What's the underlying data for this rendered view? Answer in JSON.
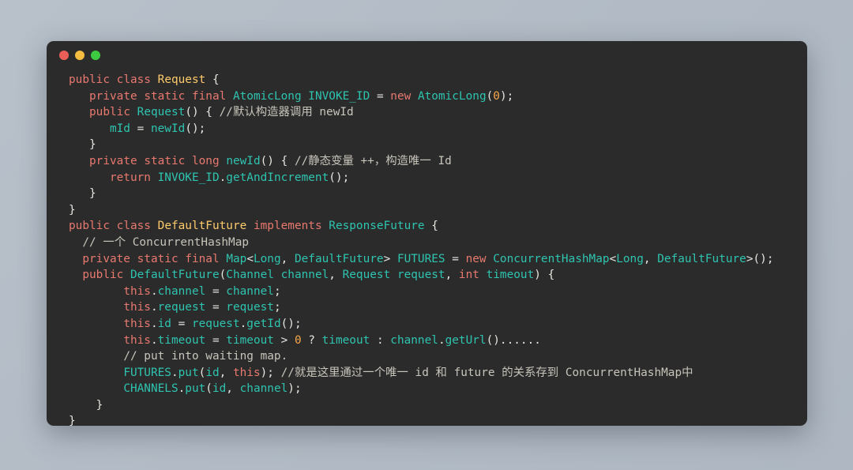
{
  "window": {
    "background_color": "#2b2b2b",
    "page_background_color": "#b4bdc7",
    "traffic_lights": [
      {
        "name": "close-button",
        "color": "#ec5f58"
      },
      {
        "name": "minimize-button",
        "color": "#f4bd3f"
      },
      {
        "name": "maximize-button",
        "color": "#3dc940"
      }
    ]
  },
  "theme": {
    "keyword": "#e8796f",
    "class_name": "#ffcb6b",
    "type": "#2ec4b0",
    "comment": "#c7c4ba",
    "number": "#f6a84b",
    "plain": "#e6e6e0"
  },
  "code": {
    "language": "java",
    "lines": [
      {
        "indent": 0,
        "tokens": [
          {
            "t": "public",
            "c": "kw"
          },
          {
            "t": " ",
            "c": "plain"
          },
          {
            "t": "class",
            "c": "kw"
          },
          {
            "t": " ",
            "c": "plain"
          },
          {
            "t": "Request",
            "c": "cls"
          },
          {
            "t": " {",
            "c": "plain"
          }
        ]
      },
      {
        "indent": 0,
        "tokens": [
          {
            "t": "   ",
            "c": "plain"
          },
          {
            "t": "private",
            "c": "kw"
          },
          {
            "t": " ",
            "c": "plain"
          },
          {
            "t": "static",
            "c": "kw"
          },
          {
            "t": " ",
            "c": "plain"
          },
          {
            "t": "final",
            "c": "kw"
          },
          {
            "t": " ",
            "c": "plain"
          },
          {
            "t": "AtomicLong",
            "c": "type"
          },
          {
            "t": " ",
            "c": "plain"
          },
          {
            "t": "INVOKE_ID",
            "c": "type"
          },
          {
            "t": " ",
            "c": "plain"
          },
          {
            "t": "=",
            "c": "plain"
          },
          {
            "t": " ",
            "c": "plain"
          },
          {
            "t": "new",
            "c": "kw"
          },
          {
            "t": " ",
            "c": "plain"
          },
          {
            "t": "AtomicLong",
            "c": "type"
          },
          {
            "t": "(",
            "c": "plain"
          },
          {
            "t": "0",
            "c": "num"
          },
          {
            "t": ");",
            "c": "plain"
          }
        ]
      },
      {
        "indent": 0,
        "tokens": [
          {
            "t": "   ",
            "c": "plain"
          },
          {
            "t": "public",
            "c": "kw"
          },
          {
            "t": " ",
            "c": "plain"
          },
          {
            "t": "Request",
            "c": "type"
          },
          {
            "t": "() { ",
            "c": "plain"
          },
          {
            "t": "//默认构造器调用 newId",
            "c": "cmt"
          }
        ]
      },
      {
        "indent": 0,
        "tokens": [
          {
            "t": "      ",
            "c": "plain"
          },
          {
            "t": "mId",
            "c": "type"
          },
          {
            "t": " = ",
            "c": "plain"
          },
          {
            "t": "newId",
            "c": "type"
          },
          {
            "t": "();",
            "c": "plain"
          }
        ]
      },
      {
        "indent": 0,
        "tokens": [
          {
            "t": "   }",
            "c": "plain"
          }
        ]
      },
      {
        "indent": 0,
        "tokens": [
          {
            "t": "   ",
            "c": "plain"
          },
          {
            "t": "private",
            "c": "kw"
          },
          {
            "t": " ",
            "c": "plain"
          },
          {
            "t": "static",
            "c": "kw"
          },
          {
            "t": " ",
            "c": "plain"
          },
          {
            "t": "long",
            "c": "kw"
          },
          {
            "t": " ",
            "c": "plain"
          },
          {
            "t": "newId",
            "c": "type"
          },
          {
            "t": "() { ",
            "c": "plain"
          },
          {
            "t": "//静态变量 ++，构造唯一 Id",
            "c": "cmt"
          }
        ]
      },
      {
        "indent": 0,
        "tokens": [
          {
            "t": "      ",
            "c": "plain"
          },
          {
            "t": "return",
            "c": "kw"
          },
          {
            "t": " ",
            "c": "plain"
          },
          {
            "t": "INVOKE_ID",
            "c": "type"
          },
          {
            "t": ".",
            "c": "plain"
          },
          {
            "t": "getAndIncrement",
            "c": "type"
          },
          {
            "t": "();",
            "c": "plain"
          }
        ]
      },
      {
        "indent": 0,
        "tokens": [
          {
            "t": "   }",
            "c": "plain"
          }
        ]
      },
      {
        "indent": 0,
        "tokens": [
          {
            "t": "}",
            "c": "plain"
          }
        ]
      },
      {
        "indent": 0,
        "tokens": [
          {
            "t": "public",
            "c": "kw"
          },
          {
            "t": " ",
            "c": "plain"
          },
          {
            "t": "class",
            "c": "kw"
          },
          {
            "t": " ",
            "c": "plain"
          },
          {
            "t": "DefaultFuture",
            "c": "cls"
          },
          {
            "t": " ",
            "c": "plain"
          },
          {
            "t": "implements",
            "c": "kw"
          },
          {
            "t": " ",
            "c": "plain"
          },
          {
            "t": "ResponseFuture",
            "c": "type"
          },
          {
            "t": " {",
            "c": "plain"
          }
        ]
      },
      {
        "indent": 0,
        "tokens": [
          {
            "t": "  ",
            "c": "plain"
          },
          {
            "t": "// 一个 ConcurrentHashMap",
            "c": "cmt"
          }
        ]
      },
      {
        "indent": 0,
        "tokens": [
          {
            "t": "  ",
            "c": "plain"
          },
          {
            "t": "private",
            "c": "kw"
          },
          {
            "t": " ",
            "c": "plain"
          },
          {
            "t": "static",
            "c": "kw"
          },
          {
            "t": " ",
            "c": "plain"
          },
          {
            "t": "final",
            "c": "kw"
          },
          {
            "t": " ",
            "c": "plain"
          },
          {
            "t": "Map",
            "c": "type"
          },
          {
            "t": "<",
            "c": "plain"
          },
          {
            "t": "Long",
            "c": "type"
          },
          {
            "t": ", ",
            "c": "plain"
          },
          {
            "t": "DefaultFuture",
            "c": "type"
          },
          {
            "t": "> ",
            "c": "plain"
          },
          {
            "t": "FUTURES",
            "c": "type"
          },
          {
            "t": " = ",
            "c": "plain"
          },
          {
            "t": "new",
            "c": "kw"
          },
          {
            "t": " ",
            "c": "plain"
          },
          {
            "t": "ConcurrentHashMap",
            "c": "type"
          },
          {
            "t": "<",
            "c": "plain"
          },
          {
            "t": "Long",
            "c": "type"
          },
          {
            "t": ", ",
            "c": "plain"
          },
          {
            "t": "DefaultFuture",
            "c": "type"
          },
          {
            "t": ">();",
            "c": "plain"
          }
        ]
      },
      {
        "indent": 0,
        "tokens": [
          {
            "t": "  ",
            "c": "plain"
          },
          {
            "t": "public",
            "c": "kw"
          },
          {
            "t": " ",
            "c": "plain"
          },
          {
            "t": "DefaultFuture",
            "c": "type"
          },
          {
            "t": "(",
            "c": "plain"
          },
          {
            "t": "Channel",
            "c": "type"
          },
          {
            "t": " ",
            "c": "plain"
          },
          {
            "t": "channel",
            "c": "type"
          },
          {
            "t": ", ",
            "c": "plain"
          },
          {
            "t": "Request",
            "c": "type"
          },
          {
            "t": " ",
            "c": "plain"
          },
          {
            "t": "request",
            "c": "type"
          },
          {
            "t": ", ",
            "c": "plain"
          },
          {
            "t": "int",
            "c": "kw"
          },
          {
            "t": " ",
            "c": "plain"
          },
          {
            "t": "timeout",
            "c": "type"
          },
          {
            "t": ") {",
            "c": "plain"
          }
        ]
      },
      {
        "indent": 0,
        "tokens": [
          {
            "t": "        ",
            "c": "plain"
          },
          {
            "t": "this",
            "c": "kw"
          },
          {
            "t": ".",
            "c": "plain"
          },
          {
            "t": "channel",
            "c": "type"
          },
          {
            "t": " = ",
            "c": "plain"
          },
          {
            "t": "channel",
            "c": "type"
          },
          {
            "t": ";",
            "c": "plain"
          }
        ]
      },
      {
        "indent": 0,
        "tokens": [
          {
            "t": "        ",
            "c": "plain"
          },
          {
            "t": "this",
            "c": "kw"
          },
          {
            "t": ".",
            "c": "plain"
          },
          {
            "t": "request",
            "c": "type"
          },
          {
            "t": " = ",
            "c": "plain"
          },
          {
            "t": "request",
            "c": "type"
          },
          {
            "t": ";",
            "c": "plain"
          }
        ]
      },
      {
        "indent": 0,
        "tokens": [
          {
            "t": "        ",
            "c": "plain"
          },
          {
            "t": "this",
            "c": "kw"
          },
          {
            "t": ".",
            "c": "plain"
          },
          {
            "t": "id",
            "c": "type"
          },
          {
            "t": " = ",
            "c": "plain"
          },
          {
            "t": "request",
            "c": "type"
          },
          {
            "t": ".",
            "c": "plain"
          },
          {
            "t": "getId",
            "c": "type"
          },
          {
            "t": "();",
            "c": "plain"
          }
        ]
      },
      {
        "indent": 0,
        "tokens": [
          {
            "t": "        ",
            "c": "plain"
          },
          {
            "t": "this",
            "c": "kw"
          },
          {
            "t": ".",
            "c": "plain"
          },
          {
            "t": "timeout",
            "c": "type"
          },
          {
            "t": " = ",
            "c": "plain"
          },
          {
            "t": "timeout",
            "c": "type"
          },
          {
            "t": " > ",
            "c": "plain"
          },
          {
            "t": "0",
            "c": "num"
          },
          {
            "t": " ? ",
            "c": "plain"
          },
          {
            "t": "timeout",
            "c": "type"
          },
          {
            "t": " : ",
            "c": "plain"
          },
          {
            "t": "channel",
            "c": "type"
          },
          {
            "t": ".",
            "c": "plain"
          },
          {
            "t": "getUrl",
            "c": "type"
          },
          {
            "t": "()......",
            "c": "plain"
          }
        ]
      },
      {
        "indent": 0,
        "tokens": [
          {
            "t": "        ",
            "c": "plain"
          },
          {
            "t": "// put into waiting map.",
            "c": "cmt"
          }
        ]
      },
      {
        "indent": 0,
        "tokens": [
          {
            "t": "        ",
            "c": "plain"
          },
          {
            "t": "FUTURES",
            "c": "type"
          },
          {
            "t": ".",
            "c": "plain"
          },
          {
            "t": "put",
            "c": "type"
          },
          {
            "t": "(",
            "c": "plain"
          },
          {
            "t": "id",
            "c": "type"
          },
          {
            "t": ", ",
            "c": "plain"
          },
          {
            "t": "this",
            "c": "kw"
          },
          {
            "t": "); ",
            "c": "plain"
          },
          {
            "t": "//就是这里通过一个唯一 id 和 future 的关系存到 ConcurrentHashMap中",
            "c": "cmt"
          }
        ]
      },
      {
        "indent": 0,
        "tokens": [
          {
            "t": "        ",
            "c": "plain"
          },
          {
            "t": "CHANNELS",
            "c": "type"
          },
          {
            "t": ".",
            "c": "plain"
          },
          {
            "t": "put",
            "c": "type"
          },
          {
            "t": "(",
            "c": "plain"
          },
          {
            "t": "id",
            "c": "type"
          },
          {
            "t": ", ",
            "c": "plain"
          },
          {
            "t": "channel",
            "c": "type"
          },
          {
            "t": ");",
            "c": "plain"
          }
        ]
      },
      {
        "indent": 0,
        "tokens": [
          {
            "t": "    }",
            "c": "plain"
          }
        ]
      },
      {
        "indent": 0,
        "tokens": [
          {
            "t": "}",
            "c": "plain"
          }
        ]
      }
    ]
  }
}
